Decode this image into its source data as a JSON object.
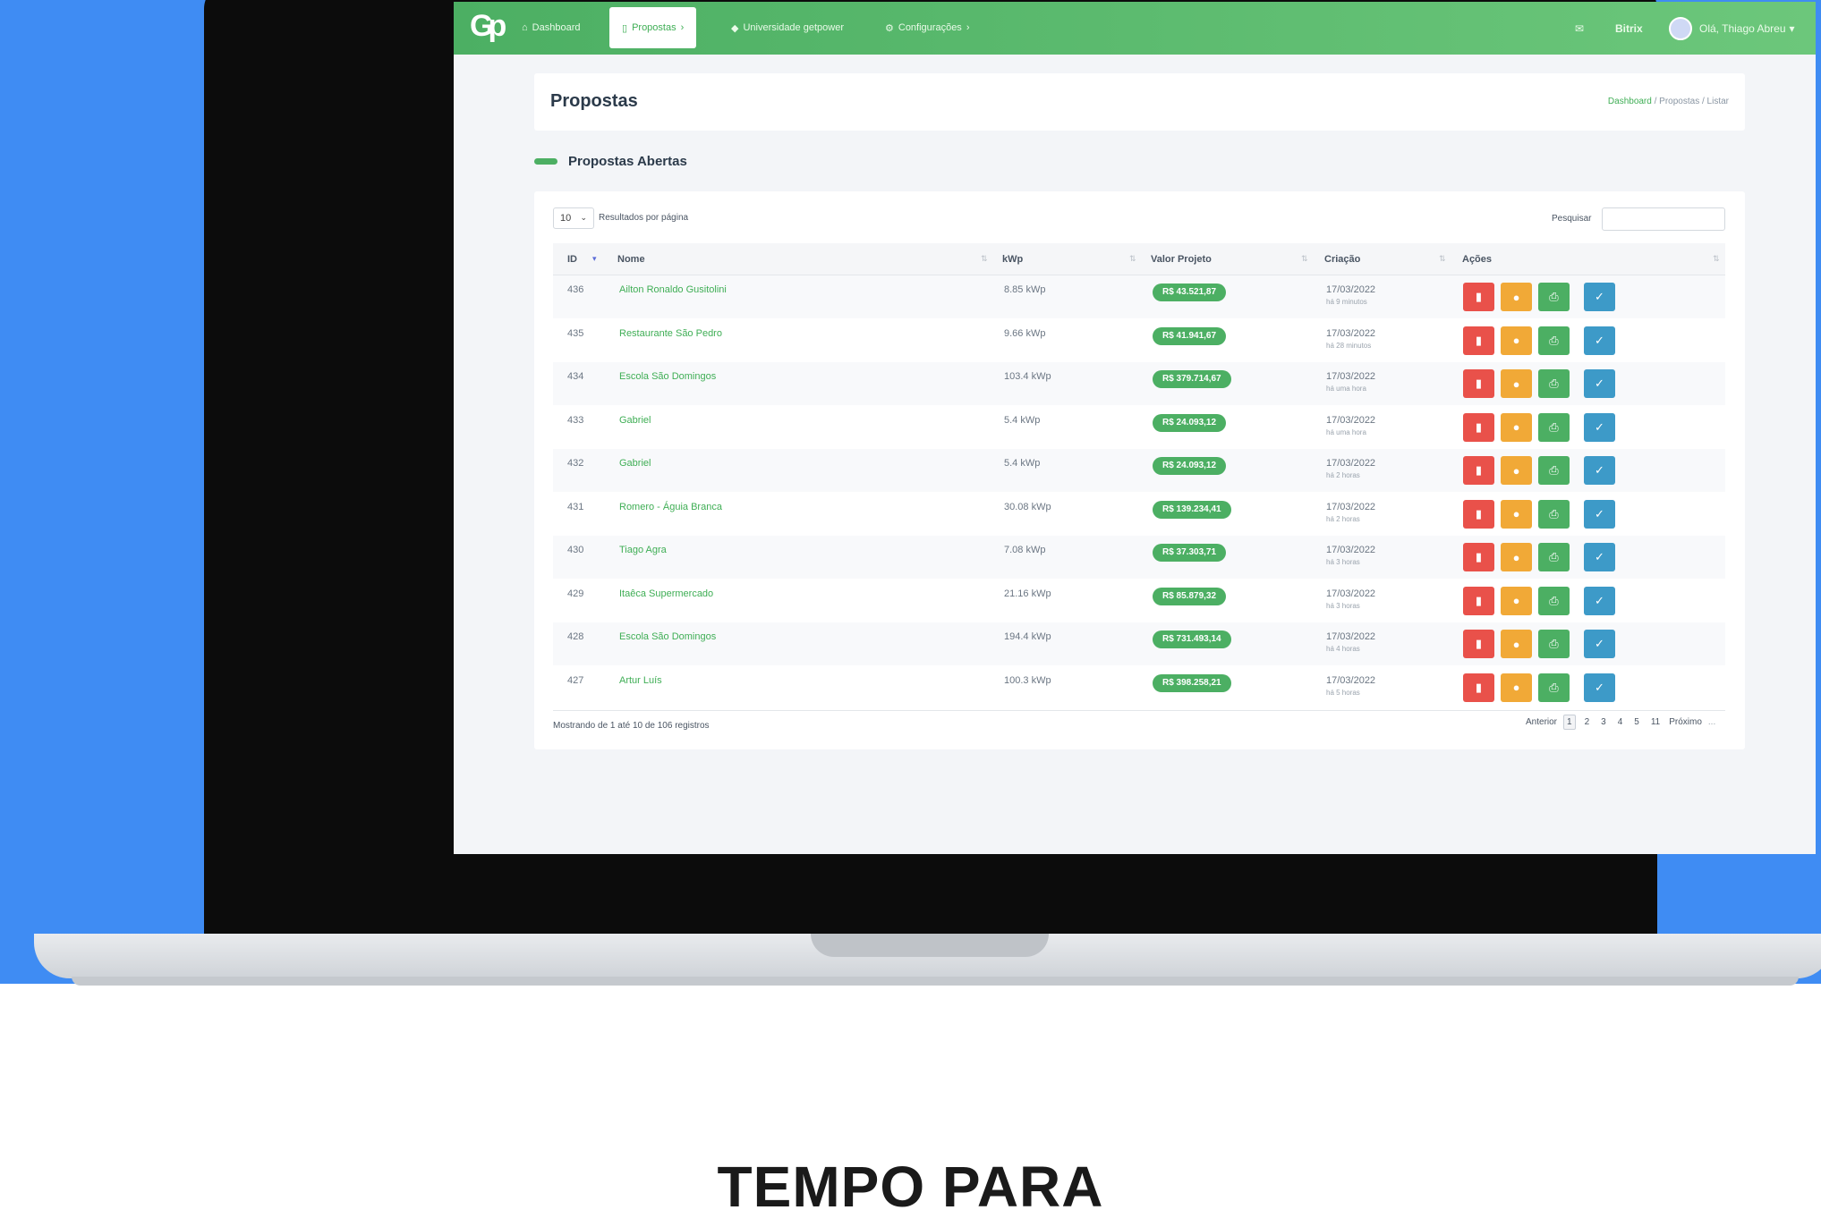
{
  "app": {
    "logo_text": "Gp",
    "nav": [
      {
        "label": "Dashboard",
        "icon": "home-icon"
      },
      {
        "label": "Propostas",
        "icon": "document-icon",
        "active": true
      },
      {
        "label": "Universidade getpower",
        "icon": "graduation-cap-icon"
      },
      {
        "label": "Configurações",
        "icon": "gears-icon"
      }
    ],
    "mail_icon": "mail-icon",
    "bitrix_label": "Bitrix",
    "user_greeting": "Olá, Thiago Abreu"
  },
  "page": {
    "title": "Propostas",
    "breadcrumb": [
      "Dashboard",
      "Propostas",
      "Listar"
    ]
  },
  "section": {
    "title": "Propostas Abertas"
  },
  "table_controls": {
    "page_size": "10",
    "per_page_label": "Resultados por página",
    "search_label": "Pesquisar",
    "search_value": ""
  },
  "table": {
    "headers": [
      "ID",
      "Nome",
      "kWp",
      "Valor Projeto",
      "Criação",
      "Ações"
    ],
    "rows": [
      {
        "id": "436",
        "name": "Ailton Ronaldo Gusitolini",
        "kwp": "8.85 kWp",
        "value": "R$ 43.521,87",
        "date": "17/03/2022",
        "ago": "há 9 minutos"
      },
      {
        "id": "435",
        "name": "Restaurante São Pedro",
        "kwp": "9.66 kWp",
        "value": "R$ 41.941,67",
        "date": "17/03/2022",
        "ago": "há 28 minutos"
      },
      {
        "id": "434",
        "name": "Escola São Domingos",
        "kwp": "103.4 kWp",
        "value": "R$ 379.714,67",
        "date": "17/03/2022",
        "ago": "há uma hora"
      },
      {
        "id": "433",
        "name": "Gabriel",
        "kwp": "5.4 kWp",
        "value": "R$ 24.093,12",
        "date": "17/03/2022",
        "ago": "há uma hora"
      },
      {
        "id": "432",
        "name": "Gabriel",
        "kwp": "5.4 kWp",
        "value": "R$ 24.093,12",
        "date": "17/03/2022",
        "ago": "há 2 horas"
      },
      {
        "id": "431",
        "name": "Romero - Águia Branca",
        "kwp": "30.08 kWp",
        "value": "R$ 139.234,41",
        "date": "17/03/2022",
        "ago": "há 2 horas"
      },
      {
        "id": "430",
        "name": "Tiago Agra",
        "kwp": "7.08 kWp",
        "value": "R$ 37.303,71",
        "date": "17/03/2022",
        "ago": "há 3 horas"
      },
      {
        "id": "429",
        "name": "Itaêca Supermercado",
        "kwp": "21.16 kWp",
        "value": "R$ 85.879,32",
        "date": "17/03/2022",
        "ago": "há 3 horas"
      },
      {
        "id": "428",
        "name": "Escola São Domingos",
        "kwp": "194.4 kWp",
        "value": "R$ 731.493,14",
        "date": "17/03/2022",
        "ago": "há 4 horas"
      },
      {
        "id": "427",
        "name": "Artur Luís",
        "kwp": "100.3 kWp",
        "value": "R$ 398.258,21",
        "date": "17/03/2022",
        "ago": "há 5 horas"
      }
    ],
    "action_icons": [
      "trash-icon",
      "comment-icon",
      "print-icon",
      "check-icon"
    ],
    "colors": {
      "delete": "#e9514a",
      "comment": "#f1a937",
      "print": "#4caf63",
      "approve": "#3d9ac8"
    }
  },
  "footer": {
    "showing": "Mostrando de 1 até 10 de 106 registros",
    "prev": "Anterior",
    "pages": [
      "1",
      "2",
      "3",
      "4",
      "5",
      "11"
    ],
    "current_page": "1",
    "next": "Próximo",
    "ellipsis": "..."
  },
  "marketing": {
    "headline": "TEMPO PARA"
  },
  "colors": {
    "background_blue": "#3f8cf3",
    "brand_green": "#4caf63"
  }
}
